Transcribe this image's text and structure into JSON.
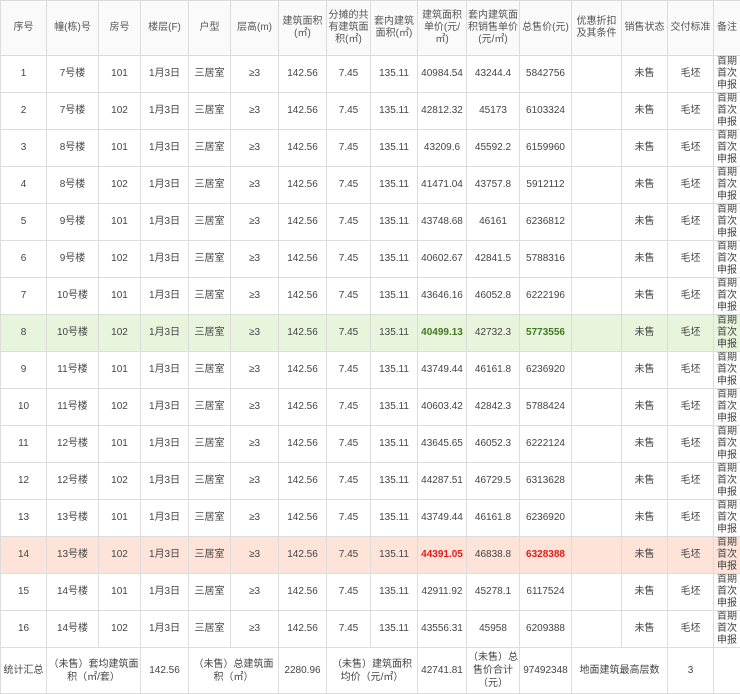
{
  "headers": [
    "序号",
    "幢(栋)号",
    "房号",
    "楼层(F)",
    "户型",
    "层高(m)",
    "建筑面积(㎡)",
    "分摊的共有建筑面积(㎡)",
    "套内建筑面积(㎡)",
    "建筑面积单价(元/㎡)",
    "套内建筑面积销售单价(元/㎡)",
    "总售价(元)",
    "优惠折扣及其条件",
    "销售状态",
    "交付标准",
    "备注"
  ],
  "rows": [
    [
      "1",
      "7号楼",
      "101",
      "1月3日",
      "三居室",
      "≥3",
      "142.56",
      "7.45",
      "135.11",
      "40984.54",
      "43244.4",
      "5842756",
      "",
      "未售",
      "毛坯",
      "首期首次申报"
    ],
    [
      "2",
      "7号楼",
      "102",
      "1月3日",
      "三居室",
      "≥3",
      "142.56",
      "7.45",
      "135.11",
      "42812.32",
      "45173",
      "6103324",
      "",
      "未售",
      "毛坯",
      "首期首次申报"
    ],
    [
      "3",
      "8号楼",
      "101",
      "1月3日",
      "三居室",
      "≥3",
      "142.56",
      "7.45",
      "135.11",
      "43209.6",
      "45592.2",
      "6159960",
      "",
      "未售",
      "毛坯",
      "首期首次申报"
    ],
    [
      "4",
      "8号楼",
      "102",
      "1月3日",
      "三居室",
      "≥3",
      "142.56",
      "7.45",
      "135.11",
      "41471.04",
      "43757.8",
      "5912112",
      "",
      "未售",
      "毛坯",
      "首期首次申报"
    ],
    [
      "5",
      "9号楼",
      "101",
      "1月3日",
      "三居室",
      "≥3",
      "142.56",
      "7.45",
      "135.11",
      "43748.68",
      "46161",
      "6236812",
      "",
      "未售",
      "毛坯",
      "首期首次申报"
    ],
    [
      "6",
      "9号楼",
      "102",
      "1月3日",
      "三居室",
      "≥3",
      "142.56",
      "7.45",
      "135.11",
      "40602.67",
      "42841.5",
      "5788316",
      "",
      "未售",
      "毛坯",
      "首期首次申报"
    ],
    [
      "7",
      "10号楼",
      "101",
      "1月3日",
      "三居室",
      "≥3",
      "142.56",
      "7.45",
      "135.11",
      "43646.16",
      "46052.8",
      "6222196",
      "",
      "未售",
      "毛坯",
      "首期首次申报"
    ],
    [
      "8",
      "10号楼",
      "102",
      "1月3日",
      "三居室",
      "≥3",
      "142.56",
      "7.45",
      "135.11",
      "40499.13",
      "42732.3",
      "5773556",
      "",
      "未售",
      "毛坯",
      "首期首次申报"
    ],
    [
      "9",
      "11号楼",
      "101",
      "1月3日",
      "三居室",
      "≥3",
      "142.56",
      "7.45",
      "135.11",
      "43749.44",
      "46161.8",
      "6236920",
      "",
      "未售",
      "毛坯",
      "首期首次申报"
    ],
    [
      "10",
      "11号楼",
      "102",
      "1月3日",
      "三居室",
      "≥3",
      "142.56",
      "7.45",
      "135.11",
      "40603.42",
      "42842.3",
      "5788424",
      "",
      "未售",
      "毛坯",
      "首期首次申报"
    ],
    [
      "11",
      "12号楼",
      "101",
      "1月3日",
      "三居室",
      "≥3",
      "142.56",
      "7.45",
      "135.11",
      "43645.65",
      "46052.3",
      "6222124",
      "",
      "未售",
      "毛坯",
      "首期首次申报"
    ],
    [
      "12",
      "12号楼",
      "102",
      "1月3日",
      "三居室",
      "≥3",
      "142.56",
      "7.45",
      "135.11",
      "44287.51",
      "46729.5",
      "6313628",
      "",
      "未售",
      "毛坯",
      "首期首次申报"
    ],
    [
      "13",
      "13号楼",
      "101",
      "1月3日",
      "三居室",
      "≥3",
      "142.56",
      "7.45",
      "135.11",
      "43749.44",
      "46161.8",
      "6236920",
      "",
      "未售",
      "毛坯",
      "首期首次申报"
    ],
    [
      "14",
      "13号楼",
      "102",
      "1月3日",
      "三居室",
      "≥3",
      "142.56",
      "7.45",
      "135.11",
      "44391.05",
      "46838.8",
      "6328388",
      "",
      "未售",
      "毛坯",
      "首期首次申报"
    ],
    [
      "15",
      "14号楼",
      "101",
      "1月3日",
      "三居室",
      "≥3",
      "142.56",
      "7.45",
      "135.11",
      "42911.92",
      "45278.1",
      "6117524",
      "",
      "未售",
      "毛坯",
      "首期首次申报"
    ],
    [
      "16",
      "14号楼",
      "102",
      "1月3日",
      "三居室",
      "≥3",
      "142.56",
      "7.45",
      "135.11",
      "43556.31",
      "45958",
      "6209388",
      "",
      "未售",
      "毛坯",
      "首期首次申报"
    ]
  ],
  "highlights": {
    "row_8": {
      "style": "green",
      "columns": [
        9,
        11
      ]
    },
    "row_14": {
      "style": "pink",
      "columns": [
        9,
        11
      ]
    }
  },
  "colors": {
    "green_bg": "#e9f4dc",
    "green_text": "#3e7a1e",
    "pink_bg": "#fde3d8",
    "red_text": "#e21b1b"
  },
  "summary": {
    "label": "统计汇总",
    "avg_area_label": "（未售）套均建筑面积（㎡/套）",
    "avg_area_value": "142.56",
    "total_area_label": "（未售）总建筑面积（㎡）",
    "total_area_value": "2280.96",
    "avg_price_label": "（未售）建筑面积均价（元/㎡）",
    "avg_price_value": "42741.81",
    "total_price_label": "（未售）总售价合计（元）",
    "total_price_value": "97492348",
    "max_floor_label": "地面建筑最高层数",
    "max_floor_value": "3"
  }
}
